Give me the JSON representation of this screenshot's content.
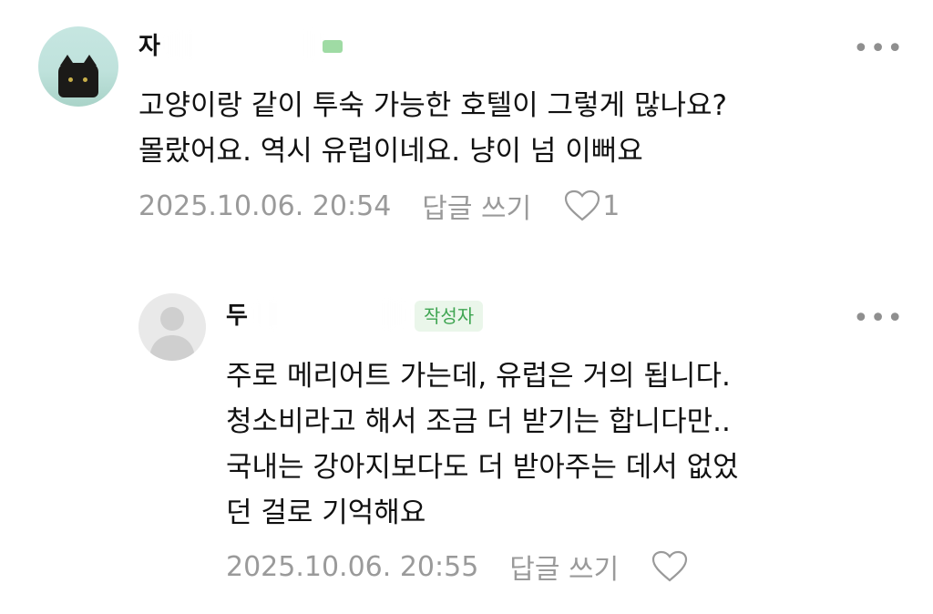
{
  "comments": [
    {
      "author_visible": "자",
      "lines": [
        "고양이랑 같이 투숙 가능한 호텔이 그렇게 많나요?",
        "몰랐어요. 역시 유럽이네요. 냥이 넘 이뻐요"
      ],
      "date": "2025.10.06. 20:54",
      "reply_label": "답글 쓰기",
      "like_count": "1"
    },
    {
      "author_visible": "두",
      "badge": "작성자",
      "lines": [
        "주로 메리어트 가는데, 유럽은 거의 됩니다.",
        "청소비라고 해서 조금 더 받기는 합니다만..",
        "국내는 강아지보다도 더 받아주는 데서 없었",
        "던 걸로 기억해요"
      ],
      "date": "2025.10.06. 20:55",
      "reply_label": "답글 쓰기",
      "like_count": ""
    }
  ],
  "icons": {
    "more": "more-dots-icon",
    "like": "heart-outline-icon"
  },
  "colors": {
    "meta_text": "#9a9a9a",
    "badge_text": "#3fa552",
    "badge_bg": "#eaf6ea"
  }
}
